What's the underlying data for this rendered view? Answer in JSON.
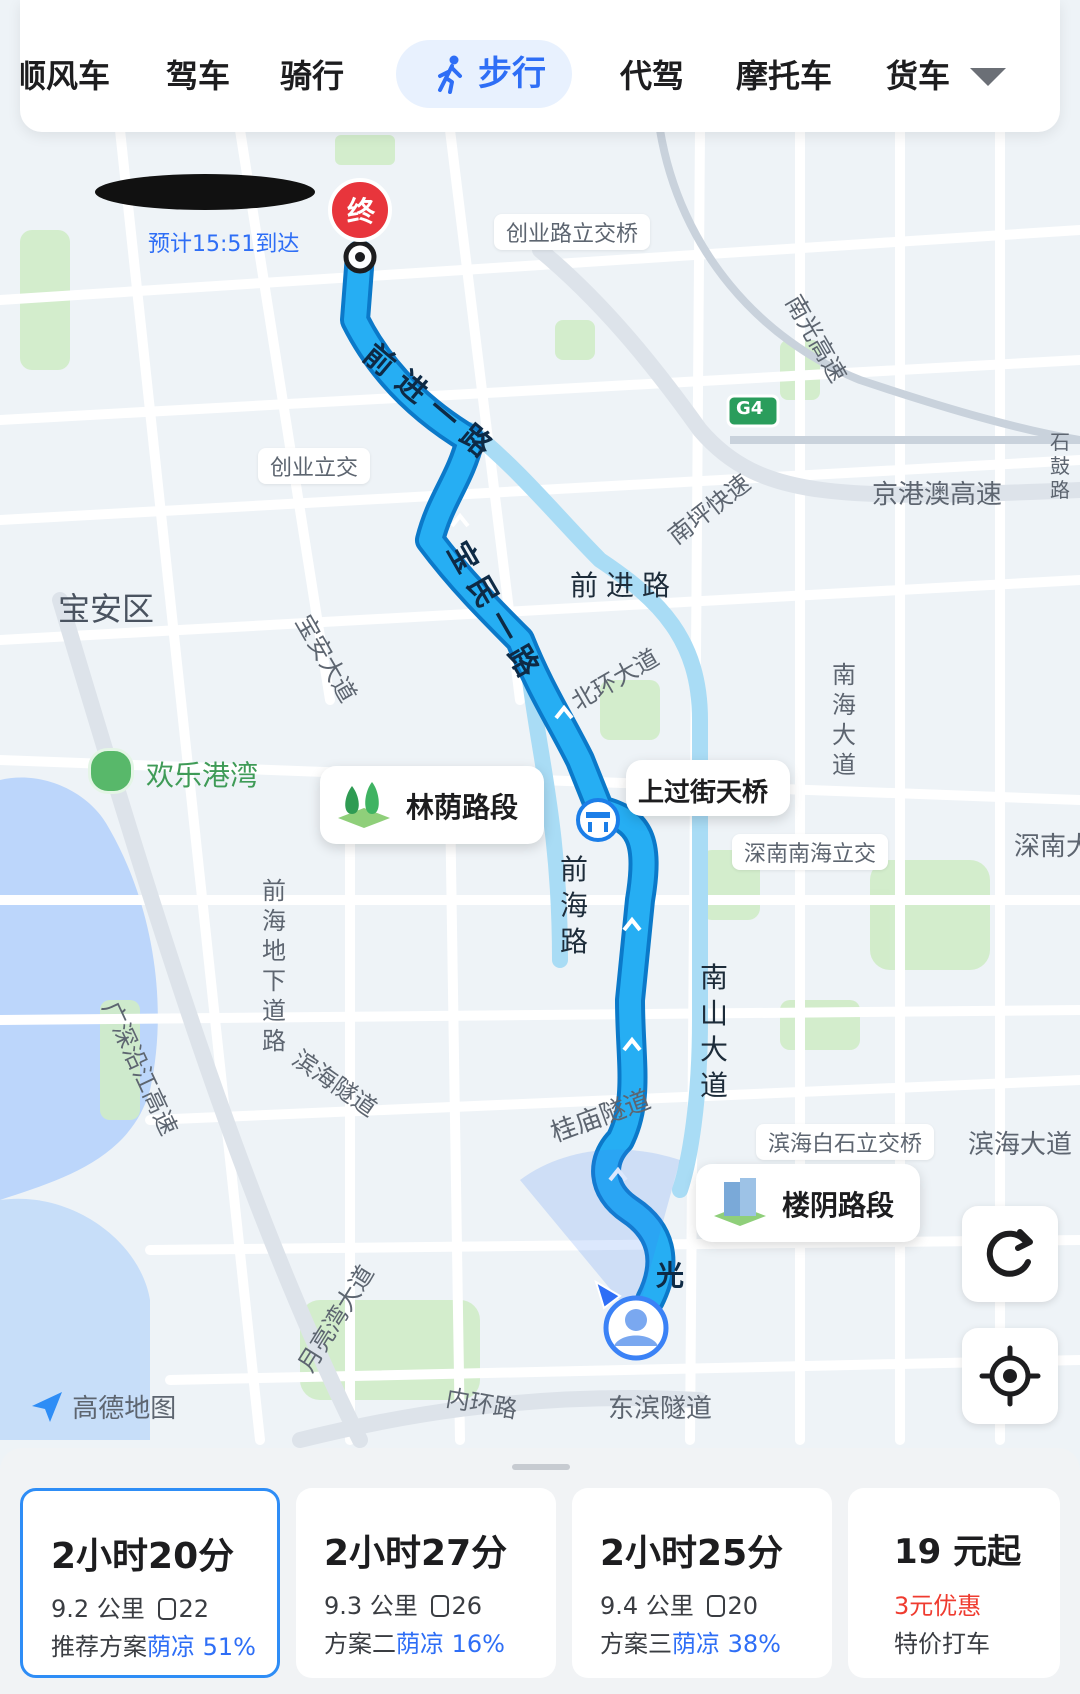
{
  "colors": {
    "accent": "#2e6ef6",
    "route": "#1fa7f0",
    "route_outline": "#0b79c9",
    "alt_route": "#a9dcf5",
    "destination": "#e8353c",
    "promo": "#ef3b2f",
    "green_area": "#cdecc6",
    "water": "#bfd9ff"
  },
  "tabs": [
    {
      "label": "顺风车"
    },
    {
      "label": "驾车"
    },
    {
      "label": "骑行"
    },
    {
      "label": "步行",
      "active": true,
      "icon": "walk-icon"
    },
    {
      "label": "代驾"
    },
    {
      "label": "摩托车"
    },
    {
      "label": "货车"
    }
  ],
  "destination": {
    "marker": "终",
    "eta": "预计15:51到达"
  },
  "map_labels": {
    "chuangye_bridge": "创业路立交桥",
    "chuangye_junction": "创业立交",
    "nanguang": "南光高速",
    "g4": "G4",
    "shigu": "石鼓路",
    "jinggangao": "京港澳高速",
    "nanping": "南坪快速",
    "qianjin_road": "前进路",
    "qianjin_yi": "前进一路",
    "baomin_yi": "宝民一路",
    "baoan_district": "宝安区",
    "baoan_avenue": "宝安大道",
    "beihuan": "北环大道",
    "nanhai_avenue": "南海大道",
    "huanle_bay": "欢乐港湾",
    "qianhai_road": "前海路",
    "shennan_nanhai": "深南南海立交",
    "shennan": "深南大道",
    "qianhai_underground": "前海地下道路",
    "binhai_tunnel": "滨海隧道",
    "guangshen_coast": "广深沿江高速",
    "nanshan_avenue": "南山大道",
    "guimiao_tunnel": "桂庙隧道",
    "binhai_baishi": "滨海白石立交桥",
    "binhai_avenue": "滨海大道",
    "yueliangwan": "月亮湾大道",
    "neihuan": "内环路",
    "dongbin_tunnel": "东滨隧道",
    "guang": "光"
  },
  "bubbles": {
    "forest": "林荫路段",
    "overpass": "上过街天桥",
    "building": "楼阴路段"
  },
  "logo": "高德地图",
  "controls": {
    "refresh": "refresh-icon",
    "locate": "locate-icon"
  },
  "options": [
    {
      "time": "2小时20分",
      "distance": "9.2 公里",
      "lights": "22",
      "label": "推荐方案",
      "shade": "荫凉 51%",
      "selected": true
    },
    {
      "time": "2小时27分",
      "distance": "9.3 公里",
      "lights": "26",
      "label": "方案二",
      "shade": "荫凉 16%"
    },
    {
      "time": "2小时25分",
      "distance": "9.4 公里",
      "lights": "20",
      "label": "方案三",
      "shade": "荫凉 38%"
    }
  ],
  "taxi": {
    "price": "19 元起",
    "discount": "3元优惠",
    "label": "特价打车"
  }
}
